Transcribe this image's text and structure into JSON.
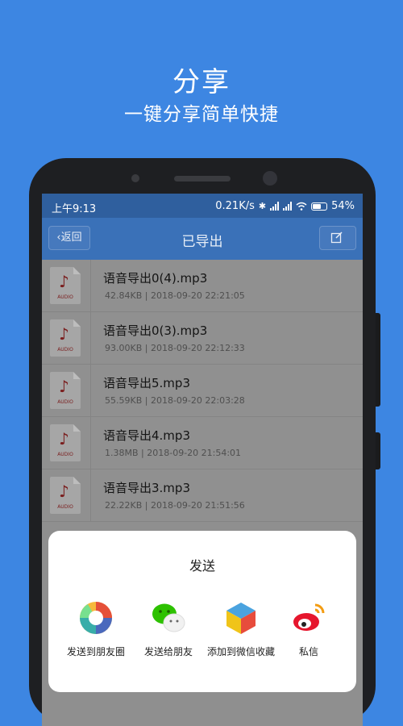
{
  "promo": {
    "title": "分享",
    "subtitle": "一键分享简单快捷"
  },
  "status_bar": {
    "time": "上午9:13",
    "speed": "0.21K/s",
    "battery": "54%"
  },
  "nav": {
    "back_label": "返回",
    "title": "已导出"
  },
  "files": [
    {
      "name": "语音导出0(4).mp3",
      "meta": "42.84KB | 2018-09-20 22:21:05",
      "icon_label": "AUDIO"
    },
    {
      "name": "语音导出0(3).mp3",
      "meta": "93.00KB | 2018-09-20 22:12:33",
      "icon_label": "AUDIO"
    },
    {
      "name": "语音导出5.mp3",
      "meta": "55.59KB | 2018-09-20 22:03:28",
      "icon_label": "AUDIO"
    },
    {
      "name": "语音导出4.mp3",
      "meta": "1.38MB | 2018-09-20 21:54:01",
      "icon_label": "AUDIO"
    },
    {
      "name": "语音导出3.mp3",
      "meta": "22.22KB | 2018-09-20 21:51:56",
      "icon_label": "AUDIO"
    }
  ],
  "share_sheet": {
    "title": "发送",
    "items": [
      {
        "label": "发送到朋友圈",
        "icon": "moments-icon"
      },
      {
        "label": "发送给朋友",
        "icon": "wechat-icon"
      },
      {
        "label": "添加到微信收藏",
        "icon": "favorites-icon"
      },
      {
        "label": "私信",
        "icon": "weibo-icon"
      }
    ]
  },
  "colors": {
    "background": "#3d86e2",
    "navbar": "#3a71b8",
    "statusbar": "#2f5f9e",
    "note": "#7a1d1d"
  }
}
